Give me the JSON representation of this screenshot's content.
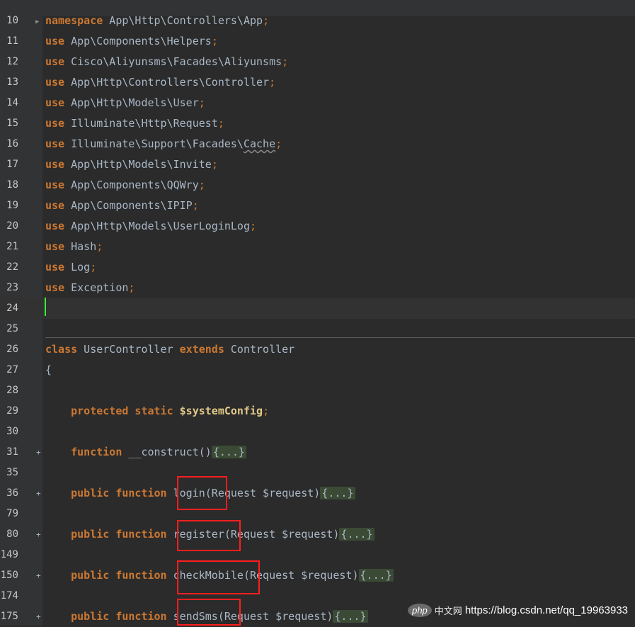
{
  "editor": {
    "lines": [
      {
        "n": "10",
        "tokens": [
          {
            "t": "namespace",
            "k": "kw"
          },
          {
            "t": " App\\Http\\Controllers\\App",
            "k": "ns"
          },
          {
            "t": ";",
            "k": "punct"
          }
        ],
        "fold": "arrow"
      },
      {
        "n": "11",
        "tokens": [
          {
            "t": "use",
            "k": "kw"
          },
          {
            "t": " App\\Components\\Helpers",
            "k": "ns"
          },
          {
            "t": ";",
            "k": "punct"
          }
        ]
      },
      {
        "n": "12",
        "tokens": [
          {
            "t": "use",
            "k": "kw"
          },
          {
            "t": " Cisco\\Aliyunsms\\Facades\\Aliyunsms",
            "k": "ns"
          },
          {
            "t": ";",
            "k": "punct"
          }
        ]
      },
      {
        "n": "13",
        "tokens": [
          {
            "t": "use",
            "k": "kw"
          },
          {
            "t": " App\\Http\\Controllers\\Controller",
            "k": "ns"
          },
          {
            "t": ";",
            "k": "punct"
          }
        ]
      },
      {
        "n": "14",
        "tokens": [
          {
            "t": "use",
            "k": "kw"
          },
          {
            "t": " App\\Http\\Models\\User",
            "k": "ns"
          },
          {
            "t": ";",
            "k": "punct"
          }
        ]
      },
      {
        "n": "15",
        "tokens": [
          {
            "t": "use",
            "k": "kw"
          },
          {
            "t": " Illuminate\\Http\\Request",
            "k": "ns"
          },
          {
            "t": ";",
            "k": "punct"
          }
        ]
      },
      {
        "n": "16",
        "tokens": [
          {
            "t": "use",
            "k": "kw"
          },
          {
            "t": " Illuminate\\Support\\Facades\\",
            "k": "ns"
          },
          {
            "t": "Cache",
            "k": "squiggle"
          },
          {
            "t": ";",
            "k": "punct"
          }
        ]
      },
      {
        "n": "17",
        "tokens": [
          {
            "t": "use",
            "k": "kw"
          },
          {
            "t": " App\\Http\\Models\\Invite",
            "k": "ns"
          },
          {
            "t": ";",
            "k": "punct"
          }
        ]
      },
      {
        "n": "18",
        "tokens": [
          {
            "t": "use",
            "k": "kw"
          },
          {
            "t": " App\\Components\\QQWry",
            "k": "ns"
          },
          {
            "t": ";",
            "k": "punct"
          }
        ]
      },
      {
        "n": "19",
        "tokens": [
          {
            "t": "use",
            "k": "kw"
          },
          {
            "t": " App\\Components\\IPIP",
            "k": "ns"
          },
          {
            "t": ";",
            "k": "punct"
          }
        ]
      },
      {
        "n": "20",
        "tokens": [
          {
            "t": "use",
            "k": "kw"
          },
          {
            "t": " App\\Http\\Models\\UserLoginLog",
            "k": "ns"
          },
          {
            "t": ";",
            "k": "punct"
          }
        ]
      },
      {
        "n": "21",
        "tokens": [
          {
            "t": "use",
            "k": "kw"
          },
          {
            "t": " Hash",
            "k": "ns"
          },
          {
            "t": ";",
            "k": "punct"
          }
        ]
      },
      {
        "n": "22",
        "tokens": [
          {
            "t": "use",
            "k": "kw"
          },
          {
            "t": " Log",
            "k": "ns"
          },
          {
            "t": ";",
            "k": "punct"
          }
        ]
      },
      {
        "n": "23",
        "tokens": [
          {
            "t": "use",
            "k": "kw"
          },
          {
            "t": " Exception",
            "k": "ns"
          },
          {
            "t": ";",
            "k": "punct"
          }
        ]
      },
      {
        "n": "24",
        "tokens": [],
        "current": true
      },
      {
        "n": "25",
        "tokens": []
      },
      {
        "n": "26",
        "tokens": [
          {
            "t": "class",
            "k": "kw"
          },
          {
            "t": " UserController ",
            "k": "cls"
          },
          {
            "t": "extends",
            "k": "kw"
          },
          {
            "t": " Controller",
            "k": "ns"
          }
        ]
      },
      {
        "n": "27",
        "tokens": [
          {
            "t": "{",
            "k": "ns"
          }
        ]
      },
      {
        "n": "28",
        "tokens": []
      },
      {
        "n": "29",
        "tokens": [
          {
            "t": "    ",
            "k": "ns"
          },
          {
            "t": "protected static ",
            "k": "kw"
          },
          {
            "t": "$systemConfig",
            "k": "var"
          },
          {
            "t": ";",
            "k": "punct"
          }
        ]
      },
      {
        "n": "30",
        "tokens": []
      },
      {
        "n": "31",
        "tokens": [
          {
            "t": "    ",
            "k": "ns"
          },
          {
            "t": "function",
            "k": "kw"
          },
          {
            "t": " __construct()",
            "k": "ns"
          },
          {
            "t": "{...}",
            "k": "folded"
          }
        ],
        "fold": "plus"
      },
      {
        "n": "35",
        "tokens": []
      },
      {
        "n": "36",
        "tokens": [
          {
            "t": "    ",
            "k": "ns"
          },
          {
            "t": "public function ",
            "k": "kw"
          },
          {
            "t": "login(Request $request)",
            "k": "ns"
          },
          {
            "t": "{...}",
            "k": "folded"
          }
        ],
        "fold": "plus"
      },
      {
        "n": "79",
        "tokens": []
      },
      {
        "n": "80",
        "tokens": [
          {
            "t": "    ",
            "k": "ns"
          },
          {
            "t": "public function ",
            "k": "kw"
          },
          {
            "t": "register(Request $request)",
            "k": "ns"
          },
          {
            "t": "{...}",
            "k": "folded"
          }
        ],
        "fold": "plus"
      },
      {
        "n": "149",
        "tokens": []
      },
      {
        "n": "150",
        "tokens": [
          {
            "t": "    ",
            "k": "ns"
          },
          {
            "t": "public function ",
            "k": "kw"
          },
          {
            "t": "checkMobile(Request $request)",
            "k": "ns"
          },
          {
            "t": "{...}",
            "k": "folded"
          }
        ],
        "fold": "plus"
      },
      {
        "n": "174",
        "tokens": []
      },
      {
        "n": "175",
        "tokens": [
          {
            "t": "    ",
            "k": "ns"
          },
          {
            "t": "public function ",
            "k": "kw"
          },
          {
            "t": "sendSms(Request $request)",
            "k": "ns"
          },
          {
            "t": "{...}",
            "k": "folded"
          }
        ],
        "fold": "plus"
      }
    ]
  },
  "watermark": {
    "badge": "php",
    "cn": "中文网",
    "url": "https://blog.csdn.net/qq_19963933"
  },
  "colors": {
    "background": "#2b2b2b",
    "keyword": "#cc7832",
    "text": "#a9b7c6",
    "caret": "#33ff33",
    "highlight_box": "#ff1e1e"
  }
}
